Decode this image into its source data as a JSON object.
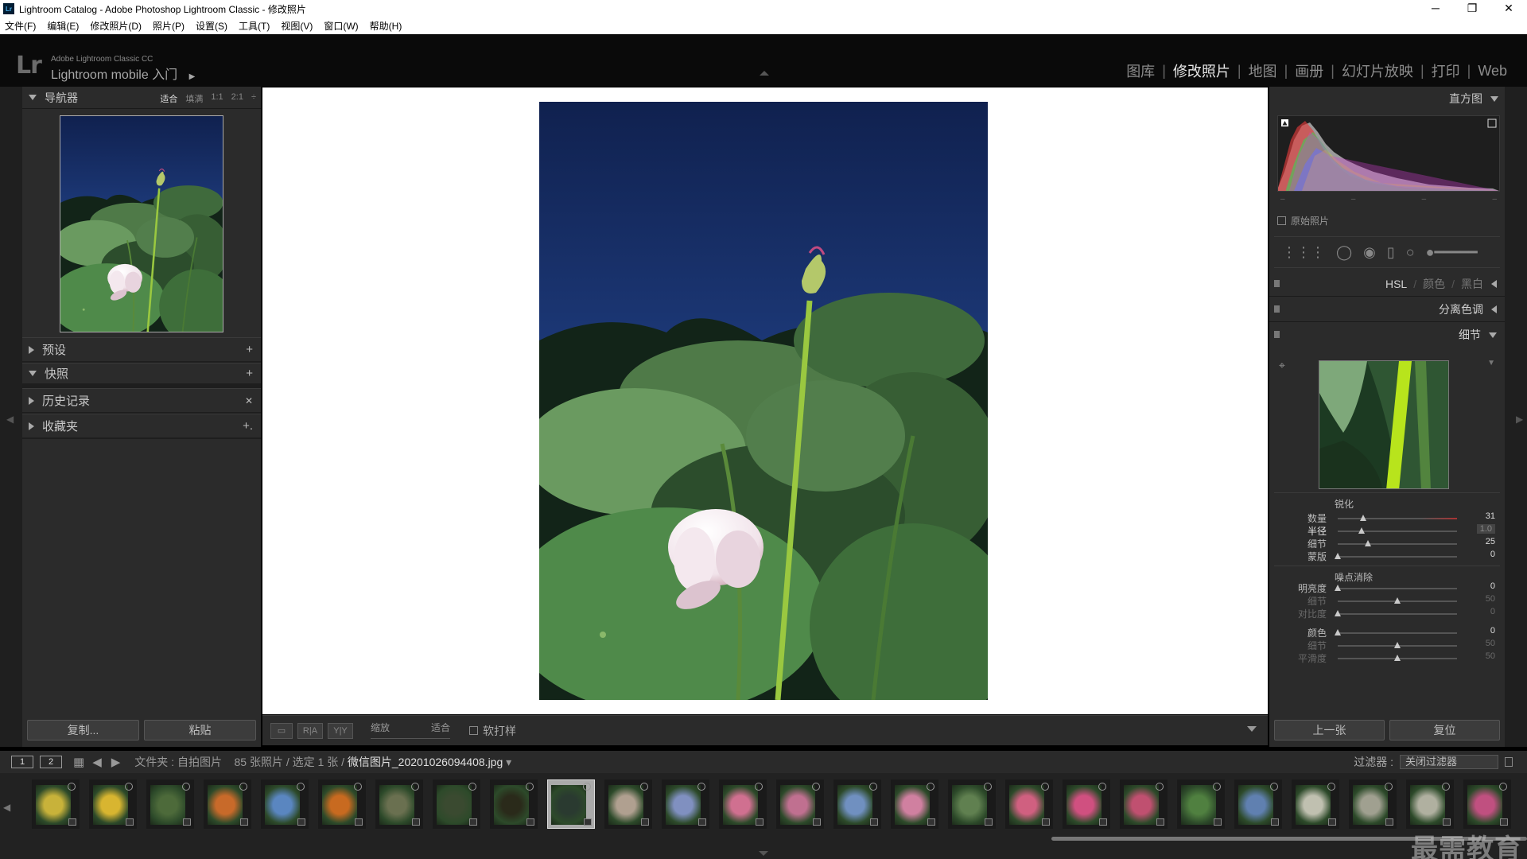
{
  "window": {
    "title": "Lightroom Catalog - Adobe Photoshop Lightroom Classic - 修改照片",
    "app_icon": "Lr",
    "controls": {
      "minimize": "─",
      "restore": "❐",
      "close": "✕"
    }
  },
  "menu": [
    "文件(F)",
    "编辑(E)",
    "修改照片(D)",
    "照片(P)",
    "设置(S)",
    "工具(T)",
    "视图(V)",
    "窗口(W)",
    "帮助(H)"
  ],
  "header": {
    "logo": "Lr",
    "brand_line1": "Adobe Lightroom Classic CC",
    "brand_line2": "Lightroom mobile 入门",
    "brand_arrow": "▶",
    "modules": [
      "图库",
      "修改照片",
      "地图",
      "画册",
      "幻灯片放映",
      "打印",
      "Web"
    ],
    "active_module": "修改照片"
  },
  "left_panel": {
    "navigator": {
      "title": "导航器",
      "zoom": [
        "适合",
        "填满",
        "1:1",
        "2:1"
      ],
      "zoom_more": "÷"
    },
    "sections": [
      {
        "label": "预设",
        "action": "+"
      },
      {
        "label": "快照",
        "action": "+",
        "expanded": true
      },
      {
        "label": "历史记录",
        "action": "✕"
      },
      {
        "label": "收藏夹",
        "action": "+."
      }
    ],
    "buttons": {
      "copy": "复制...",
      "paste": "粘贴"
    }
  },
  "toolbar": {
    "view_icons": [
      "▭",
      "R|A",
      "Y|Y"
    ],
    "zoom_label": "缩放",
    "zoom_value": "适合",
    "soft_proof": "软打样",
    "soft_proof_checked": false
  },
  "right_panel": {
    "histogram": {
      "title": "直方图",
      "ticks": [
        "–",
        "–",
        "–",
        "–"
      ],
      "original_photo": "原始照片",
      "original_checked": false
    },
    "sections": {
      "hsl": "HSL",
      "color": "颜色",
      "bw": "黑白",
      "split_toning": "分离色调",
      "detail": "细节"
    },
    "sharpening": {
      "title": "锐化",
      "sliders": [
        {
          "label": "数量",
          "value": "31",
          "pos": 0.21
        },
        {
          "label": "半径",
          "value": "1.0",
          "pos": 0.2
        },
        {
          "label": "细节",
          "value": "25",
          "pos": 0.25
        },
        {
          "label": "蒙版",
          "value": "0",
          "pos": 0.0
        }
      ]
    },
    "noise_reduction": {
      "title": "噪点消除",
      "luminance": [
        {
          "label": "明亮度",
          "value": "0",
          "pos": 0.0
        },
        {
          "label": "细节",
          "value": "50",
          "pos": 0.5
        },
        {
          "label": "对比度",
          "value": "0",
          "pos": 0.0
        }
      ],
      "color": [
        {
          "label": "颜色",
          "value": "0",
          "pos": 0.0
        },
        {
          "label": "细节",
          "value": "50",
          "pos": 0.5
        },
        {
          "label": "平滑度",
          "value": "50",
          "pos": 0.5
        }
      ]
    },
    "buttons": {
      "previous": "上一张",
      "reset": "复位"
    }
  },
  "filmstrip": {
    "page1": "1",
    "page2": "2",
    "source_prefix": "文件夹 : 自拍图片",
    "count_text": "85 张照片 / 选定 1 张 /",
    "filename": "微信图片_20201026094408.jpg",
    "filename_dropdown": "▾",
    "filter_label": "过滤器 :",
    "filter_value": "关闭过滤器",
    "watermark": "最需教育",
    "thumb_colors": [
      "#c8b23a",
      "#d8b530",
      "#4d6a3a",
      "#c86a2a",
      "#5a86c0",
      "#c86a20",
      "#6a7050",
      "#3a4a30",
      "#2a2a1a",
      "#2a3a30",
      "#b0a090",
      "#8090c0",
      "#d07090",
      "#c07090",
      "#7090c0",
      "#d080a0",
      "#608050",
      "#d06080",
      "#d05080",
      "#c05070",
      "#508040",
      "#6080b0",
      "#c0c0b0",
      "#a0a090",
      "#b0b0a0",
      "#c05080"
    ]
  }
}
